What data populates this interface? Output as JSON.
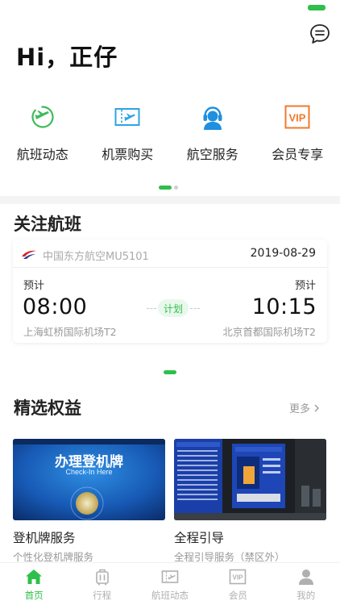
{
  "header": {
    "greeting": "Hi，正仔",
    "message_icon": "chat-bubble-icon"
  },
  "quick_actions": [
    {
      "label": "航班动态",
      "icon": "flight-status-icon",
      "color": "#3dbb5b"
    },
    {
      "label": "机票购买",
      "icon": "ticket-icon",
      "color": "#2fa3e6"
    },
    {
      "label": "航空服务",
      "icon": "customer-service-icon",
      "color": "#1f8fe0"
    },
    {
      "label": "会员专享",
      "icon": "vip-icon",
      "color": "#f07a2d"
    }
  ],
  "followed_flights": {
    "title": "关注航班",
    "card": {
      "airline": "中国东方航空MU5101",
      "date": "2019-08-29",
      "dep_label": "预计",
      "arr_label": "预计",
      "dep_time": "08:00",
      "arr_time": "10:15",
      "status": "计划",
      "dep_airport": "上海虹桥国际机场T2",
      "arr_airport": "北京首都国际机场T2"
    }
  },
  "benefits": {
    "title": "精选权益",
    "more": "更多",
    "items": [
      {
        "title": "登机牌服务",
        "subtitle": "个性化登机牌服务",
        "image_text": "办理登机牌",
        "image_subtext": "Check-In Here"
      },
      {
        "title": "全程引导",
        "subtitle": "全程引导服务（禁区外）"
      }
    ]
  },
  "tabbar": [
    {
      "label": "首页",
      "icon": "home-icon",
      "active": true
    },
    {
      "label": "行程",
      "icon": "luggage-icon",
      "active": false
    },
    {
      "label": "航班动态",
      "icon": "flight-board-icon",
      "active": false
    },
    {
      "label": "会员",
      "icon": "vip-badge-icon",
      "active": false
    },
    {
      "label": "我的",
      "icon": "profile-icon",
      "active": false
    }
  ],
  "colors": {
    "accent": "#2fbf4a",
    "muted_text": "#999999"
  }
}
